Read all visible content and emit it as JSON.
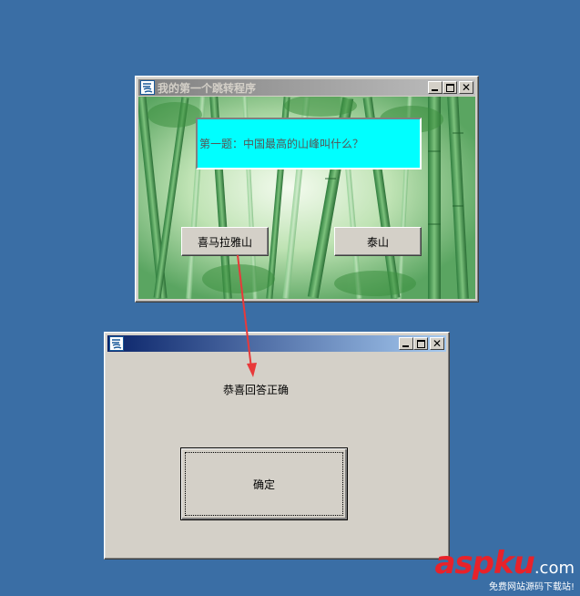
{
  "main_window": {
    "title": "我的第一个跳转程序",
    "question": "第一题：中国最高的山峰叫什么？",
    "answer_a": "喜马拉雅山",
    "answer_b": "泰山",
    "controls": {
      "minimize": "_",
      "maximize": "□",
      "close": "✕"
    }
  },
  "result_window": {
    "title": "",
    "message": "恭喜回答正确",
    "confirm_label": "确定",
    "controls": {
      "minimize": "_",
      "maximize": "□",
      "close": "✕"
    }
  },
  "annotation": {
    "color": "#e8393a"
  },
  "watermark": {
    "brand": "aspku",
    "domain": ".com",
    "tagline": "免费网站源码下载站!"
  },
  "colors": {
    "desktop": "#3a6ea5",
    "question_bg": "#00ffff",
    "window_face": "#d4d0c8",
    "active_title_start": "#0a246a",
    "active_title_end": "#a6caf0"
  },
  "icons": [
    "app-icon",
    "minimize-icon",
    "maximize-icon",
    "close-icon",
    "arrow-annotation"
  ]
}
